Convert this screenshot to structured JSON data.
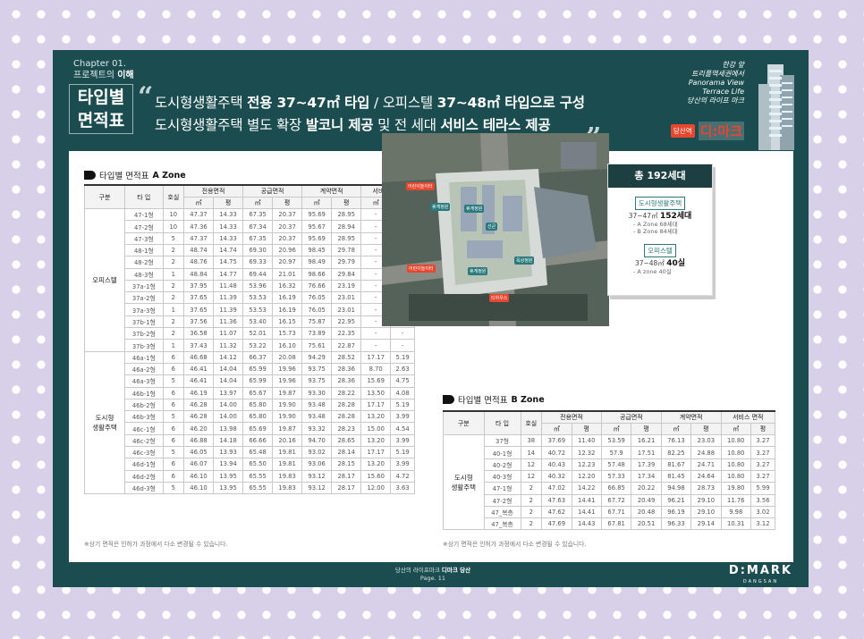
{
  "header": {
    "chapter": "Chapter 01.",
    "project_pre": "프로젝트의 ",
    "project_bold": "이해",
    "title_l1": "타입별",
    "title_l2": "면적표",
    "line1": [
      {
        "t": "도시형생활주택 ",
        "b": false
      },
      {
        "t": "전용 37~47㎡ 타입",
        "b": true
      },
      {
        "t": " / ",
        "b": false
      },
      {
        "t": "오피스텔 ",
        "b": false
      },
      {
        "t": "37~48㎡ 타입으로 구성",
        "b": true
      }
    ],
    "line2": [
      {
        "t": "도시형생활주택 별도 확장 ",
        "b": false
      },
      {
        "t": "발코니 제공",
        "b": true
      },
      {
        "t": " 및 ",
        "b": false
      },
      {
        "t": "전 세대 ",
        "b": false
      },
      {
        "t": "서비스 테라스 제공",
        "b": true
      }
    ]
  },
  "brand": {
    "lines": [
      "한강 앞",
      "트리플역세권에서",
      "Panorama View",
      "Terrace Life",
      "당산의 라이프 마크"
    ],
    "tag": "당산역",
    "name": "디:마크"
  },
  "table_a": {
    "title_pre": "타입별 면적표 ",
    "title_bold": "A Zone",
    "headers": {
      "gubun": "구분",
      "type": "타 입",
      "units": "호실",
      "g1": "전용면적",
      "g2": "공급면적",
      "g3": "계약면적",
      "g4": "서비스 면적",
      "m2": "㎡",
      "py": "평"
    },
    "groups": [
      {
        "name": "오피스텔",
        "rows": [
          [
            "47-1형",
            "10",
            "47.37",
            "14.33",
            "67.35",
            "20.37",
            "95.69",
            "28.95",
            "-",
            "-"
          ],
          [
            "47-2형",
            "10",
            "47.36",
            "14.33",
            "67.34",
            "20.37",
            "95.67",
            "28.94",
            "-",
            "-"
          ],
          [
            "47-3형",
            "5",
            "47.37",
            "14.33",
            "67.35",
            "20.37",
            "95.69",
            "28.95",
            "-",
            "-"
          ],
          [
            "48-1형",
            "2",
            "48.74",
            "14.74",
            "69.30",
            "20.96",
            "98.45",
            "29.78",
            "-",
            "-"
          ],
          [
            "48-2형",
            "2",
            "48.76",
            "14.75",
            "69.33",
            "20.97",
            "98.49",
            "29.79",
            "-",
            "-"
          ],
          [
            "48-3형",
            "1",
            "48.84",
            "14.77",
            "69.44",
            "21.01",
            "98.66",
            "29.84",
            "-",
            "-"
          ],
          [
            "37a-1형",
            "2",
            "37.95",
            "11.48",
            "53.96",
            "16.32",
            "76.66",
            "23.19",
            "-",
            "-"
          ],
          [
            "37a-2형",
            "2",
            "37.65",
            "11.39",
            "53.53",
            "16.19",
            "76.05",
            "23.01",
            "-",
            "-"
          ],
          [
            "37a-3형",
            "1",
            "37.65",
            "11.39",
            "53.53",
            "16.19",
            "76.05",
            "23.01",
            "-",
            "-"
          ],
          [
            "37b-1형",
            "2",
            "37.56",
            "11.36",
            "53.40",
            "16.15",
            "75.87",
            "22.95",
            "-",
            "-"
          ],
          [
            "37b-2형",
            "2",
            "36.58",
            "11.07",
            "52.01",
            "15.73",
            "73.89",
            "22.35",
            "-",
            "-"
          ],
          [
            "37b-3형",
            "1",
            "37.43",
            "11.32",
            "53.22",
            "16.10",
            "75.61",
            "22.87",
            "-",
            "-"
          ]
        ]
      },
      {
        "name": "도시형\n생활주택",
        "rows": [
          [
            "46a-1형",
            "6",
            "46.68",
            "14.12",
            "66.37",
            "20.08",
            "94.29",
            "28.52",
            "17.17",
            "5.19"
          ],
          [
            "46a-2형",
            "6",
            "46.41",
            "14.04",
            "65.99",
            "19.96",
            "93.75",
            "28.36",
            "8.70",
            "2.63"
          ],
          [
            "46a-3형",
            "5",
            "46.41",
            "14.04",
            "65.99",
            "19.96",
            "93.75",
            "28.36",
            "15.69",
            "4.75"
          ],
          [
            "46b-1형",
            "6",
            "46.19",
            "13.97",
            "65.67",
            "19.87",
            "93.30",
            "28.22",
            "13.50",
            "4.08"
          ],
          [
            "46b-2형",
            "6",
            "46.28",
            "14.00",
            "65.80",
            "19.90",
            "93.48",
            "28.28",
            "17.17",
            "5.19"
          ],
          [
            "46b-3형",
            "5",
            "46.28",
            "14.00",
            "65.80",
            "19.90",
            "93.48",
            "28.28",
            "13.20",
            "3.99"
          ],
          [
            "46c-1형",
            "6",
            "46.20",
            "13.98",
            "65.69",
            "19.87",
            "93.32",
            "28.23",
            "15.00",
            "4.54"
          ],
          [
            "46c-2형",
            "6",
            "46.88",
            "14.18",
            "66.66",
            "20.16",
            "94.70",
            "28.65",
            "13.20",
            "3.99"
          ],
          [
            "46c-3형",
            "5",
            "46.05",
            "13.93",
            "65.48",
            "19.81",
            "93.02",
            "28.14",
            "17.17",
            "5.19"
          ],
          [
            "46d-1형",
            "6",
            "46.07",
            "13.94",
            "65.50",
            "19.81",
            "93.06",
            "28.15",
            "13.20",
            "3.99"
          ],
          [
            "46d-2형",
            "6",
            "46.10",
            "13.95",
            "65.55",
            "19.83",
            "93.12",
            "28.17",
            "15.60",
            "4.72"
          ],
          [
            "46d-3형",
            "5",
            "46.10",
            "13.95",
            "65.55",
            "19.83",
            "93.12",
            "28.17",
            "12.00",
            "3.63"
          ]
        ]
      }
    ],
    "note": "※상기 면적은 인허가 과정에서 다소 변경될 수 있습니다."
  },
  "table_b": {
    "title_pre": "타입별 면적표 ",
    "title_bold": "B Zone",
    "groups": [
      {
        "name": "도시형\n생활주택",
        "rows": [
          [
            "37형",
            "38",
            "37.69",
            "11.40",
            "53.59",
            "16.21",
            "76.13",
            "23.03",
            "10.80",
            "3.27"
          ],
          [
            "40-1형",
            "14",
            "40.72",
            "12.32",
            "57.9",
            "17.51",
            "82.25",
            "24.88",
            "10.80",
            "3.27"
          ],
          [
            "40-2형",
            "12",
            "40.43",
            "12.23",
            "57.48",
            "17.39",
            "81.67",
            "24.71",
            "10.80",
            "3.27"
          ],
          [
            "40-3형",
            "12",
            "40.32",
            "12.20",
            "57.33",
            "17.34",
            "81.45",
            "24.64",
            "10.80",
            "3.27"
          ],
          [
            "47-1형",
            "2",
            "47.02",
            "14.22",
            "66.85",
            "20.22",
            "94.98",
            "28.73",
            "19.80",
            "5.99"
          ],
          [
            "47-2형",
            "2",
            "47.63",
            "14.41",
            "67.72",
            "20.49",
            "96.21",
            "29.10",
            "11.76",
            "3.56"
          ],
          [
            "47_복층",
            "2",
            "47.62",
            "14.41",
            "67.71",
            "20.48",
            "96.19",
            "29.10",
            "9.98",
            "3.02"
          ],
          [
            "47_복층",
            "2",
            "47.69",
            "14.43",
            "67.81",
            "20.51",
            "96.33",
            "29.14",
            "10.31",
            "3.12"
          ]
        ]
      }
    ],
    "note": "※상기 면적은 인허가 과정에서 다소 변경될 수 있습니다."
  },
  "summary": {
    "total": "총 192세대",
    "sec1_label": "도시형생활주택",
    "sec1_value_pre": "37~47㎡ ",
    "sec1_value_bold": "152세대",
    "sec1_sub1": "- A Zone 68세대",
    "sec1_sub2": "- B Zone 84세대",
    "sec2_label": "오피스텔",
    "sec2_value_pre": "37~48㎡ ",
    "sec2_value_bold": "40실",
    "sec2_sub1": "- A zone 40실"
  },
  "map": {
    "labels": [
      "어린이놀이터",
      "휴게정원",
      "휴게정원",
      "선큰",
      "휴게정원",
      "어린이놀이터",
      "티하우스",
      "옥상정원"
    ]
  },
  "footer": {
    "line1": "당산의 라이프마크 ",
    "line1_bold": "디마크 당산",
    "line2": "Page. 11",
    "logo": "D:MARK",
    "logo_sub": "DANGSAN"
  }
}
